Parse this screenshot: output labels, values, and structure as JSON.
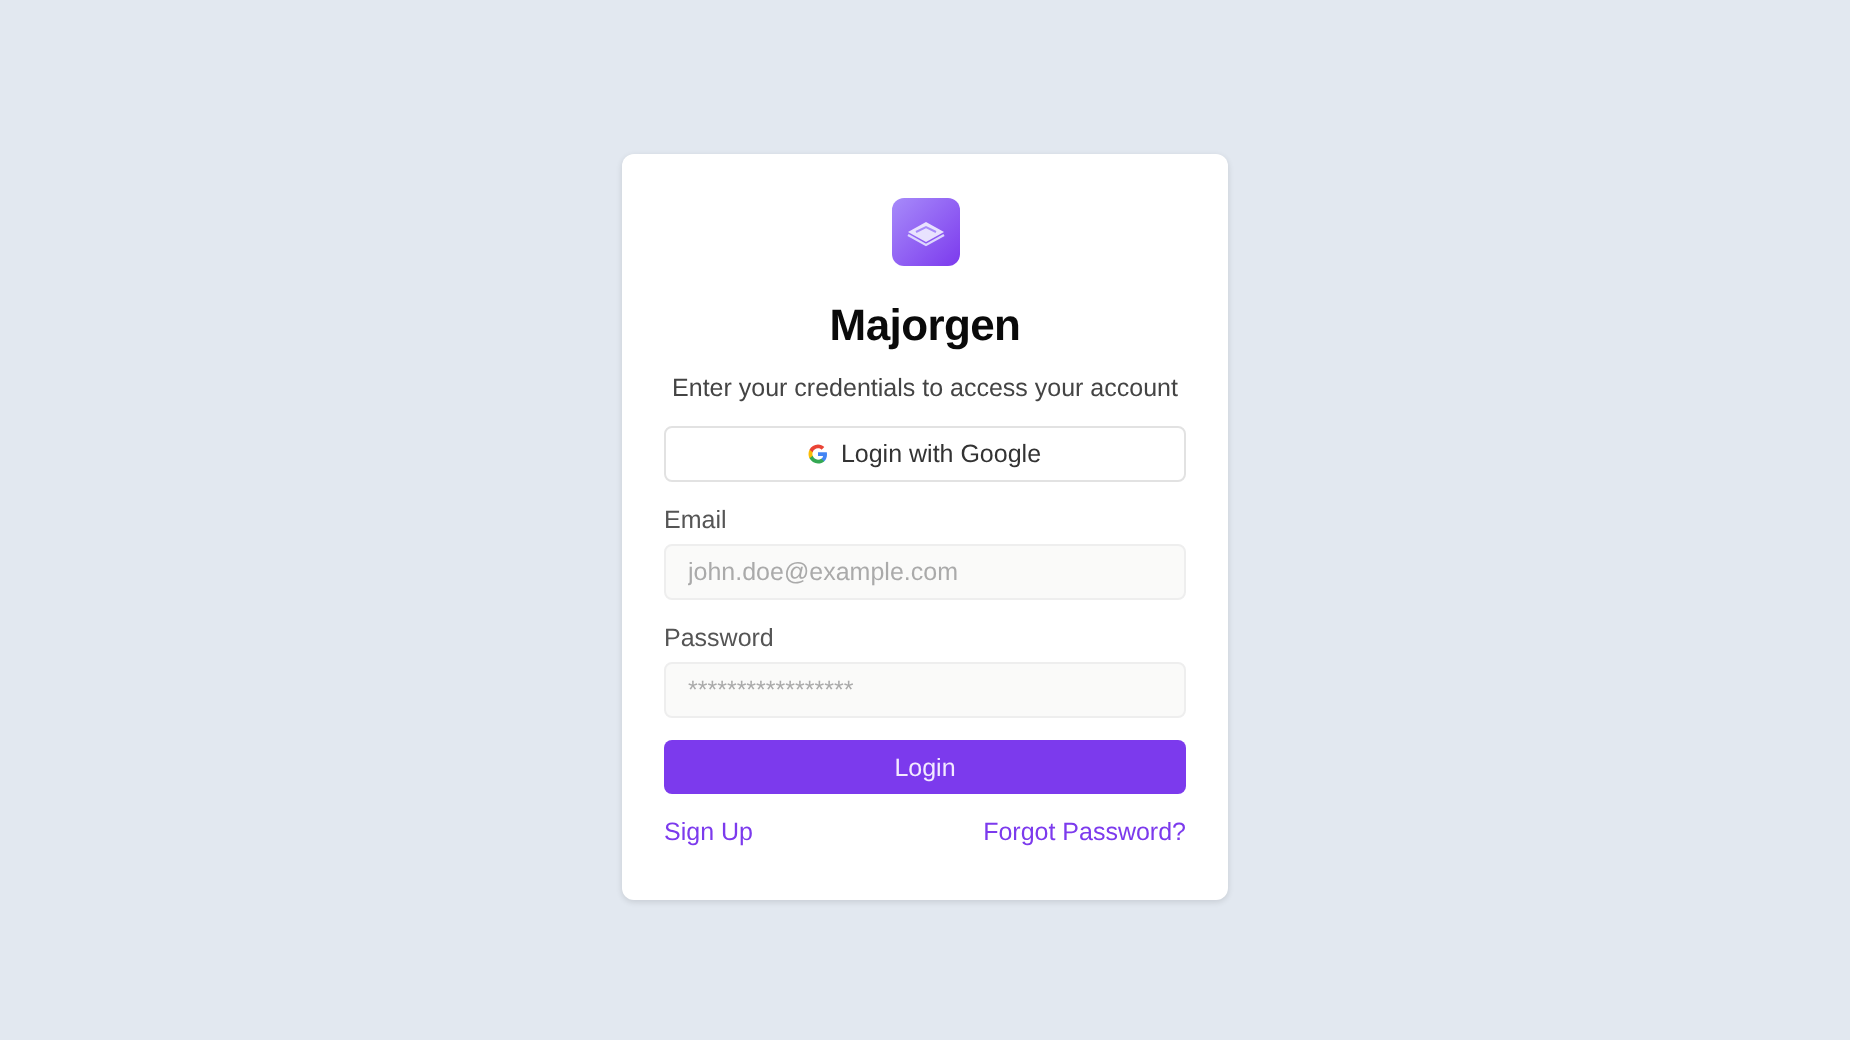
{
  "brand": {
    "name": "Majorgen",
    "subtitle": "Enter your credentials to access your account"
  },
  "google_button": {
    "label": "Login with Google"
  },
  "fields": [
    {
      "label": "Email",
      "placeholder": "john.doe@example.com"
    },
    {
      "label": "Password",
      "placeholder": "*****************"
    }
  ],
  "submit_button": {
    "label": "Login"
  },
  "links": [
    {
      "label": "Sign Up"
    },
    {
      "label": "Forgot Password?"
    }
  ]
}
